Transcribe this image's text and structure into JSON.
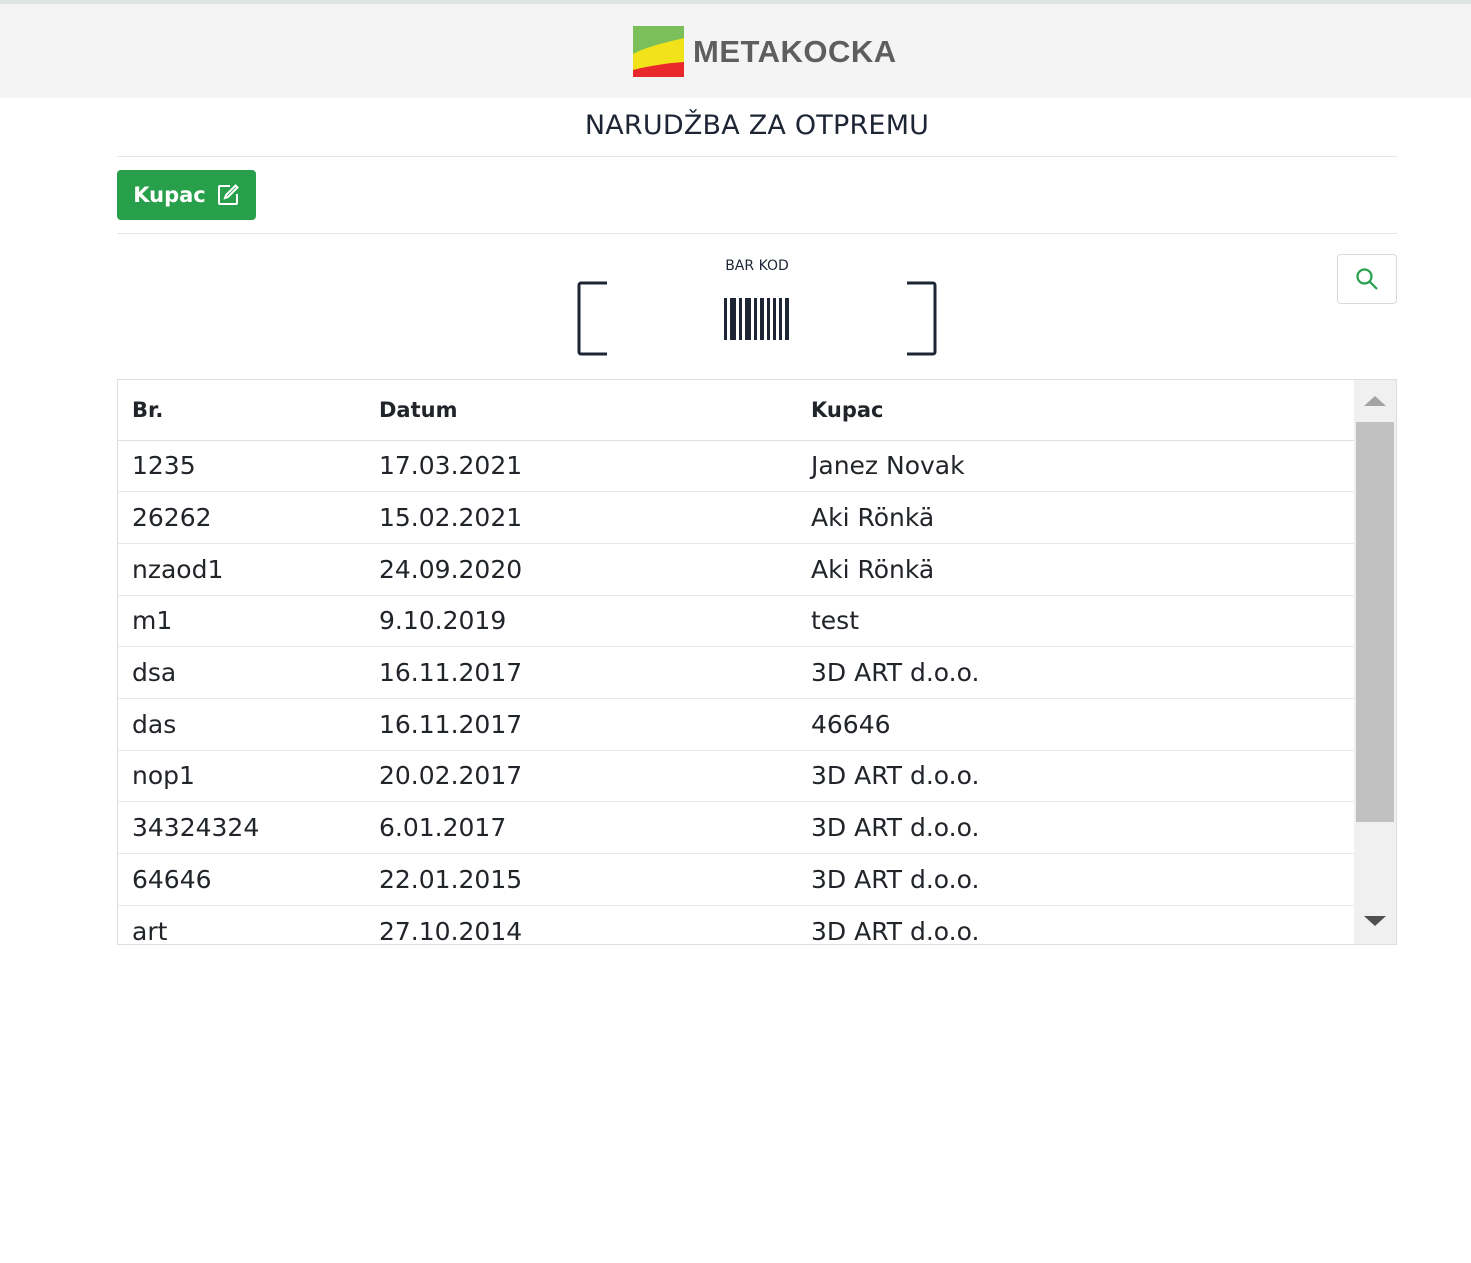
{
  "brand": {
    "name": "METAKOCKA"
  },
  "page": {
    "title": "NARUDŽBA ZA OTPREMU"
  },
  "toolbar": {
    "kupac_label": "Kupac"
  },
  "barcode": {
    "label": "BAR KOD"
  },
  "table": {
    "headers": [
      "Br.",
      "Datum",
      "Kupac"
    ],
    "rows": [
      [
        "1235",
        "17.03.2021",
        "Janez Novak"
      ],
      [
        "26262",
        "15.02.2021",
        "Aki Rönkä"
      ],
      [
        "nzaod1",
        "24.09.2020",
        "Aki Rönkä"
      ],
      [
        "m1",
        "9.10.2019",
        "test"
      ],
      [
        "dsa",
        "16.11.2017",
        "3D ART d.o.o."
      ],
      [
        "das",
        "16.11.2017",
        "46646"
      ],
      [
        "nop1",
        "20.02.2017",
        "3D ART d.o.o."
      ],
      [
        "34324324",
        "6.01.2017",
        "3D ART d.o.o."
      ],
      [
        "64646",
        "22.01.2015",
        "3D ART d.o.o."
      ],
      [
        "art",
        "27.10.2014",
        "3D ART d.o.o."
      ]
    ]
  },
  "colors": {
    "primary_green": "#28a04b",
    "text_dark": "#1d2535",
    "logo_green": "#7bbf5a",
    "logo_yellow": "#f2e21a",
    "logo_red": "#e8282a"
  },
  "icons": {
    "kupac": "edit-icon",
    "search": "search-icon",
    "barcode": "barcode-icon"
  }
}
